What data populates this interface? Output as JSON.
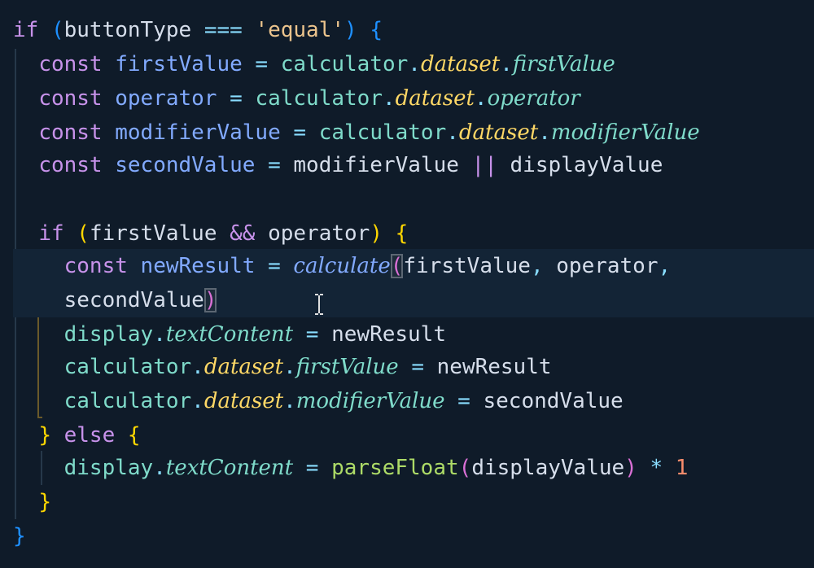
{
  "editor": {
    "lines": [
      {
        "id": "l1",
        "tokens": [
          {
            "t": "if ",
            "c": "kw"
          },
          {
            "t": "(",
            "c": "brack-b"
          },
          {
            "t": "buttonType ",
            "c": "txt"
          },
          {
            "t": "===",
            "c": "op"
          },
          {
            "t": " ",
            "c": "txt"
          },
          {
            "t": "'equal'",
            "c": "str"
          },
          {
            "t": ")",
            "c": "brack-b"
          },
          {
            "t": " ",
            "c": "txt"
          },
          {
            "t": "{",
            "c": "brack-b"
          }
        ]
      },
      {
        "id": "l2",
        "tokens": [
          {
            "t": "  ",
            "c": "txt"
          },
          {
            "t": "const ",
            "c": "kw"
          },
          {
            "t": "firstValue ",
            "c": "var"
          },
          {
            "t": "= ",
            "c": "op"
          },
          {
            "t": "calculator",
            "c": "prop"
          },
          {
            "t": ".",
            "c": "punc"
          },
          {
            "t": "dataset",
            "c": "yel ital"
          },
          {
            "t": ".",
            "c": "punc"
          },
          {
            "t": "firstValue",
            "c": "prop ital"
          }
        ]
      },
      {
        "id": "l3",
        "tokens": [
          {
            "t": "  ",
            "c": "txt"
          },
          {
            "t": "const ",
            "c": "kw"
          },
          {
            "t": "operator ",
            "c": "var"
          },
          {
            "t": "= ",
            "c": "op"
          },
          {
            "t": "calculator",
            "c": "prop"
          },
          {
            "t": ".",
            "c": "punc"
          },
          {
            "t": "dataset",
            "c": "yel ital"
          },
          {
            "t": ".",
            "c": "punc"
          },
          {
            "t": "operator",
            "c": "prop ital"
          }
        ]
      },
      {
        "id": "l4",
        "tokens": [
          {
            "t": "  ",
            "c": "txt"
          },
          {
            "t": "const ",
            "c": "kw"
          },
          {
            "t": "modifierValue ",
            "c": "var"
          },
          {
            "t": "= ",
            "c": "op"
          },
          {
            "t": "calculator",
            "c": "prop"
          },
          {
            "t": ".",
            "c": "punc"
          },
          {
            "t": "dataset",
            "c": "yel ital"
          },
          {
            "t": ".",
            "c": "punc"
          },
          {
            "t": "modifierValue",
            "c": "prop ital"
          }
        ]
      },
      {
        "id": "l5",
        "tokens": [
          {
            "t": "  ",
            "c": "txt"
          },
          {
            "t": "const ",
            "c": "kw"
          },
          {
            "t": "secondValue ",
            "c": "var"
          },
          {
            "t": "= ",
            "c": "op"
          },
          {
            "t": "modifierValue ",
            "c": "txt"
          },
          {
            "t": "||",
            "c": "kw"
          },
          {
            "t": " displayValue",
            "c": "txt"
          }
        ]
      },
      {
        "id": "l6",
        "tokens": []
      },
      {
        "id": "l7",
        "tokens": [
          {
            "t": "  ",
            "c": "txt"
          },
          {
            "t": "if ",
            "c": "kw"
          },
          {
            "t": "(",
            "c": "brack-y"
          },
          {
            "t": "firstValue ",
            "c": "txt"
          },
          {
            "t": "&&",
            "c": "kw"
          },
          {
            "t": " operator",
            "c": "txt"
          },
          {
            "t": ")",
            "c": "brack-y"
          },
          {
            "t": " ",
            "c": "txt"
          },
          {
            "t": "{",
            "c": "brack-y"
          }
        ]
      },
      {
        "id": "l8",
        "tokens": [
          {
            "t": "    ",
            "c": "txt"
          },
          {
            "t": "const ",
            "c": "kw"
          },
          {
            "t": "newResult ",
            "c": "var"
          },
          {
            "t": "= ",
            "c": "op"
          },
          {
            "t": "calculate",
            "c": "call"
          },
          {
            "t": "(",
            "c": "brack-p match"
          },
          {
            "t": "firstValue",
            "c": "txt"
          },
          {
            "t": ",",
            "c": "punc"
          },
          {
            "t": " operator",
            "c": "txt"
          },
          {
            "t": ",",
            "c": "punc"
          }
        ]
      },
      {
        "id": "l9",
        "tokens": [
          {
            "t": "    ",
            "c": "txt"
          },
          {
            "t": "secondValue",
            "c": "txt"
          },
          {
            "t": ")",
            "c": "brack-p match"
          }
        ]
      },
      {
        "id": "l10",
        "tokens": [
          {
            "t": "    ",
            "c": "txt"
          },
          {
            "t": "display",
            "c": "prop"
          },
          {
            "t": ".",
            "c": "punc"
          },
          {
            "t": "textContent",
            "c": "prop ital"
          },
          {
            "t": " = ",
            "c": "op"
          },
          {
            "t": "newResult",
            "c": "txt"
          }
        ]
      },
      {
        "id": "l11",
        "tokens": [
          {
            "t": "    ",
            "c": "txt"
          },
          {
            "t": "calculator",
            "c": "prop"
          },
          {
            "t": ".",
            "c": "punc"
          },
          {
            "t": "dataset",
            "c": "yel ital"
          },
          {
            "t": ".",
            "c": "punc"
          },
          {
            "t": "firstValue",
            "c": "prop ital"
          },
          {
            "t": " = ",
            "c": "op"
          },
          {
            "t": "newResult",
            "c": "txt"
          }
        ]
      },
      {
        "id": "l12",
        "tokens": [
          {
            "t": "    ",
            "c": "txt"
          },
          {
            "t": "calculator",
            "c": "prop"
          },
          {
            "t": ".",
            "c": "punc"
          },
          {
            "t": "dataset",
            "c": "yel ital"
          },
          {
            "t": ".",
            "c": "punc"
          },
          {
            "t": "modifierValue",
            "c": "prop ital"
          },
          {
            "t": " = ",
            "c": "op"
          },
          {
            "t": "secondValue",
            "c": "txt"
          }
        ]
      },
      {
        "id": "l13",
        "tokens": [
          {
            "t": "  ",
            "c": "txt"
          },
          {
            "t": "}",
            "c": "brack-y"
          },
          {
            "t": " else ",
            "c": "kw"
          },
          {
            "t": "{",
            "c": "brack-y"
          }
        ]
      },
      {
        "id": "l14",
        "tokens": [
          {
            "t": "    ",
            "c": "txt"
          },
          {
            "t": "display",
            "c": "prop"
          },
          {
            "t": ".",
            "c": "punc"
          },
          {
            "t": "textContent",
            "c": "prop ital"
          },
          {
            "t": " = ",
            "c": "op"
          },
          {
            "t": "parseFloat",
            "c": "fn"
          },
          {
            "t": "(",
            "c": "brack-p"
          },
          {
            "t": "displayValue",
            "c": "txt"
          },
          {
            "t": ")",
            "c": "brack-p"
          },
          {
            "t": " * ",
            "c": "op"
          },
          {
            "t": "1",
            "c": "num"
          }
        ]
      },
      {
        "id": "l15",
        "tokens": [
          {
            "t": "  ",
            "c": "txt"
          },
          {
            "t": "}",
            "c": "brack-y"
          }
        ]
      },
      {
        "id": "l16",
        "tokens": [
          {
            "t": "}",
            "c": "brack-b"
          }
        ]
      }
    ]
  }
}
